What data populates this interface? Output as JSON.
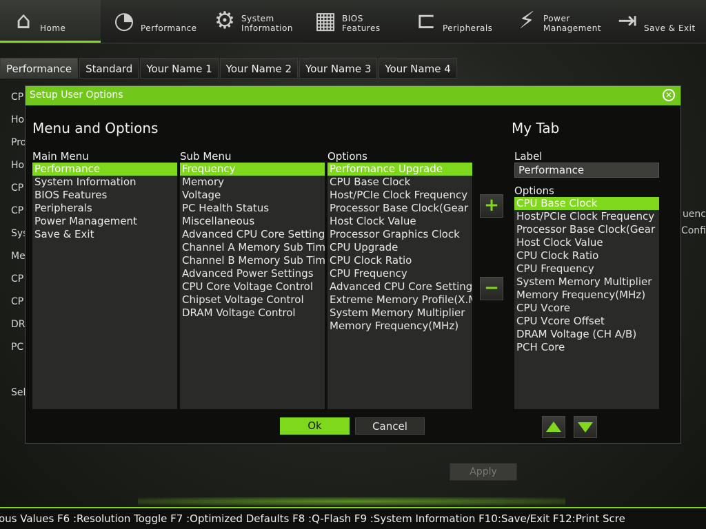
{
  "nav": [
    {
      "label": "Home",
      "icon": "home-icon",
      "glyph": "⌂"
    },
    {
      "label": "Performance",
      "icon": "gauge-icon",
      "glyph": "◔"
    },
    {
      "label": "System\nInformation",
      "icon": "gear-icon",
      "glyph": "⚙"
    },
    {
      "label": "BIOS\nFeatures",
      "icon": "bios-chip-icon",
      "glyph": "▦"
    },
    {
      "label": "Peripherals",
      "icon": "connector-icon",
      "glyph": "⊏"
    },
    {
      "label": "Power\nManagement",
      "icon": "power-bolt-icon",
      "glyph": "⚡"
    },
    {
      "label": "Save & Exit",
      "icon": "exit-door-icon",
      "glyph": "⇥"
    }
  ],
  "tabs": [
    "Performance",
    "Standard",
    "Your Name 1",
    "Your Name 2",
    "Your Name 3",
    "Your Name 4"
  ],
  "background_left": [
    "CP",
    "Ho",
    "Pro",
    "Ho",
    "CP",
    "CP",
    "Sys",
    "Me",
    "CP",
    "CP",
    "DR",
    "PC",
    "Sel"
  ],
  "background_right": [
    "uenc",
    "Confi"
  ],
  "apply_label": "Apply",
  "footer_text": "ous Values F6 :Resolution Toggle F7 :Optimized Defaults F8 :Q-Flash F9 :System Information F10:Save/Exit F12:Print Scre",
  "dialog": {
    "title": "Setup User Options",
    "menu_heading": "Menu and Options",
    "mytab_heading": "My Tab",
    "main_menu": {
      "header": "Main Menu",
      "items": [
        "Performance",
        "System Information",
        "BIOS Features",
        "Peripherals",
        "Power Management",
        "Save & Exit"
      ],
      "selected": 0
    },
    "sub_menu": {
      "header": "Sub Menu",
      "items": [
        "Frequency",
        "Memory",
        "Voltage",
        "PC Health Status",
        "Miscellaneous",
        "Advanced CPU Core Settings",
        "Channel A Memory Sub Timings",
        "Channel B Memory Sub Timings",
        "Advanced Power Settings",
        "CPU Core Voltage Control",
        "Chipset Voltage Control",
        "DRAM Voltage Control"
      ],
      "selected": 0
    },
    "options": {
      "header": "Options",
      "items": [
        "Performance Upgrade",
        "CPU Base Clock",
        "Host/PCIe Clock Frequency",
        "Processor Base Clock(Gear Ratio)",
        "Host Clock Value",
        "Processor Graphics Clock",
        "CPU Upgrade",
        "CPU Clock Ratio",
        "CPU Frequency",
        "Advanced CPU Core Settings",
        "Extreme Memory Profile(X.M.P.)",
        "System Memory Multiplier",
        "Memory Frequency(MHz)"
      ],
      "selected": 0
    },
    "add_symbol": "+",
    "remove_symbol": "−",
    "label_header": "Label",
    "label_value": "Performance",
    "mytab_options": {
      "header": "Options",
      "items": [
        "CPU Base Clock",
        "Host/PCIe Clock Frequency",
        "Processor Base Clock(Gear Ratio)",
        "Host Clock Value",
        "CPU Clock Ratio",
        "CPU Frequency",
        "System Memory Multiplier",
        "Memory Frequency(MHz)",
        "CPU Vcore",
        "CPU Vcore Offset",
        "DRAM Voltage    (CH A/B)",
        "PCH Core"
      ],
      "selected": 0
    },
    "ok_label": "Ok",
    "cancel_label": "Cancel"
  },
  "colors": {
    "accent": "#7fd81c",
    "title_bar": "#72c81a",
    "list_bg": "#2a2b28"
  }
}
